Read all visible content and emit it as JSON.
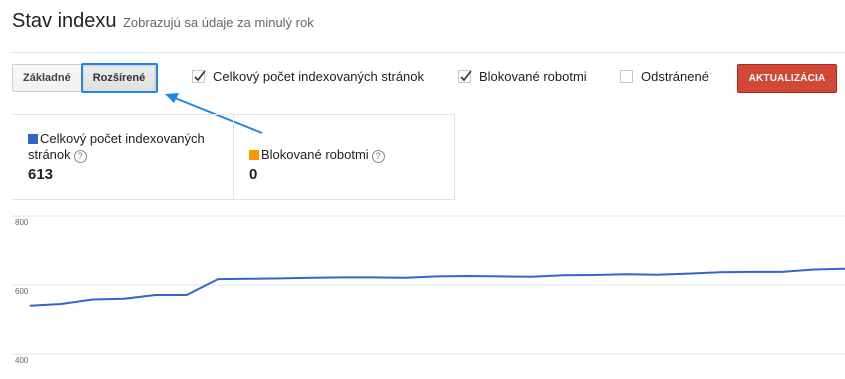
{
  "header": {
    "title": "Stav indexu",
    "subtitle": "Zobrazujú sa údaje za minulý rok"
  },
  "view_toggle": {
    "basic_label": "Základné",
    "advanced_label": "Rozšírené",
    "selected": "Rozšírené"
  },
  "filters": [
    {
      "label": "Celkový počet indexovaných stránok",
      "checked": true
    },
    {
      "label": "Blokované robotmi",
      "checked": true
    },
    {
      "label": "Odstránené",
      "checked": false
    }
  ],
  "update_button": {
    "label": "AKTUALIZÁCIA",
    "color": "#d14836"
  },
  "stats": [
    {
      "label": "Celkový počet indexovaných stránok",
      "value": "613",
      "color": "#3366cc",
      "icon": "help-icon"
    },
    {
      "label": "Blokované robotmi",
      "value": "0",
      "color": "#ff9900",
      "icon": "help-icon"
    }
  ],
  "annotation": {
    "color": "#1c87e8",
    "icon": "arrow-icon"
  },
  "chart_data": {
    "type": "line",
    "y_ticks": [
      "800",
      "600",
      "400"
    ],
    "ylim": [
      400,
      800
    ],
    "grid": true,
    "series": [
      {
        "color": "#3366cc",
        "values": [
          540,
          545,
          558,
          560,
          571,
          571,
          617,
          618,
          619,
          621,
          622,
          622,
          621,
          625,
          626,
          625,
          624,
          628,
          629,
          631,
          630,
          633,
          637,
          638,
          638,
          645,
          647
        ]
      }
    ]
  }
}
